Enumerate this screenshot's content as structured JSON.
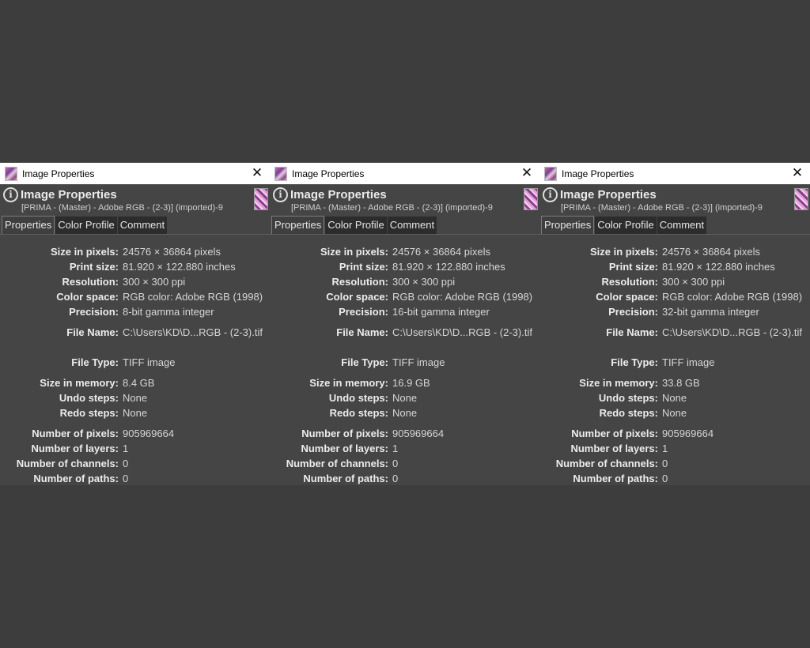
{
  "dialogs": [
    {
      "window_title": "Image Properties",
      "close": "✕",
      "header_title": "Image Properties",
      "header_subtitle": "[PRIMA - (Master) - Adobe RGB - (2-3)] (imported)-9",
      "tabs": [
        "Properties",
        "Color Profile",
        "Comment"
      ],
      "active_tab": "Properties",
      "props": {
        "size_px": "24576 × 36864 pixels",
        "print_size": "81.920 × 122.880 inches",
        "resolution": "300 × 300 ppi",
        "color_space": "RGB color: Adobe RGB (1998)",
        "precision": "8-bit gamma integer",
        "file_name": "C:\\Users\\KD\\D...RGB - (2-3).tif",
        "file_type": "TIFF image",
        "size_mem": "8.4 GB",
        "undo": "None",
        "redo": "None",
        "num_pixels": "905969664",
        "num_layers": "1",
        "num_channels": "0",
        "num_paths": "0"
      }
    },
    {
      "window_title": "Image Properties",
      "close": "✕",
      "header_title": "Image Properties",
      "header_subtitle": "[PRIMA - (Master) - Adobe RGB - (2-3)] (imported)-9",
      "tabs": [
        "Properties",
        "Color Profile",
        "Comment"
      ],
      "active_tab": "Properties",
      "props": {
        "size_px": "24576 × 36864 pixels",
        "print_size": "81.920 × 122.880 inches",
        "resolution": "300 × 300 ppi",
        "color_space": "RGB color: Adobe RGB (1998)",
        "precision": "16-bit gamma integer",
        "file_name": "C:\\Users\\KD\\D...RGB - (2-3).tif",
        "file_type": "TIFF image",
        "size_mem": "16.9 GB",
        "undo": "None",
        "redo": "None",
        "num_pixels": "905969664",
        "num_layers": "1",
        "num_channels": "0",
        "num_paths": "0"
      }
    },
    {
      "window_title": "Image Properties",
      "close": "✕",
      "header_title": "Image Properties",
      "header_subtitle": "[PRIMA - (Master) - Adobe RGB - (2-3)] (imported)-9",
      "tabs": [
        "Properties",
        "Color Profile",
        "Comment"
      ],
      "active_tab": "Properties",
      "props": {
        "size_px": "24576 × 36864 pixels",
        "print_size": "81.920 × 122.880 inches",
        "resolution": "300 × 300 ppi",
        "color_space": "RGB color: Adobe RGB (1998)",
        "precision": "32-bit gamma integer",
        "file_name": "C:\\Users\\KD\\D...RGB - (2-3).tif",
        "file_type": "TIFF image",
        "size_mem": "33.8 GB",
        "undo": "None",
        "redo": "None",
        "num_pixels": "905969664",
        "num_layers": "1",
        "num_channels": "0",
        "num_paths": "0"
      }
    }
  ],
  "labels": {
    "size_px": "Size in pixels:",
    "print_size": "Print size:",
    "resolution": "Resolution:",
    "color_space": "Color space:",
    "precision": "Precision:",
    "file_name": "File Name:",
    "file_type": "File Type:",
    "size_mem": "Size in memory:",
    "undo": "Undo steps:",
    "redo": "Redo steps:",
    "num_pixels": "Number of pixels:",
    "num_layers": "Number of layers:",
    "num_channels": "Number of channels:",
    "num_paths": "Number of paths:"
  },
  "colors": {
    "background": "#3d3d3d",
    "panel": "#454545",
    "titlebar": "#ffffff"
  },
  "icons": {
    "app": "gimp-image-icon",
    "info": "info-icon",
    "close": "close-icon",
    "thumbnail": "image-thumbnail"
  }
}
